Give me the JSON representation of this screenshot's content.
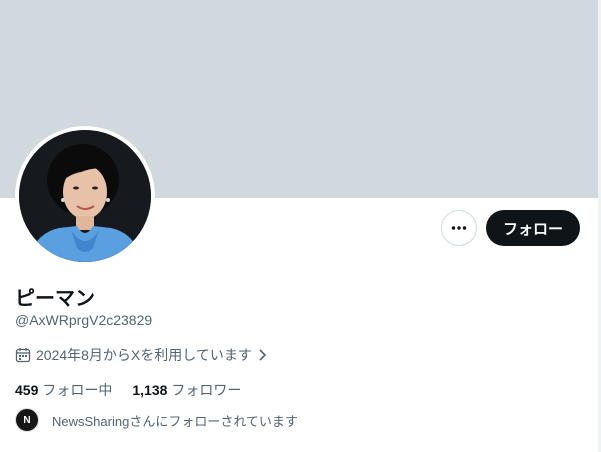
{
  "profile": {
    "display_name": "ピーマン",
    "handle": "@AxWRprgV2c23829",
    "joined": "2024年8月からXを利用しています",
    "following_count": "459",
    "following_label": "フォロー中",
    "followers_count": "1,138",
    "followers_label": "フォロワー",
    "followed_by_text": "NewsSharingさんにフォローされています",
    "followed_by_avatar_letter": "N"
  },
  "actions": {
    "follow_label": "フォロー",
    "more_icon": "more-horizontal-icon"
  },
  "colors": {
    "banner": "#cfd9de",
    "primary_text": "#0f1419",
    "secondary_text": "#536471",
    "follow_button_bg": "#0f1419"
  }
}
